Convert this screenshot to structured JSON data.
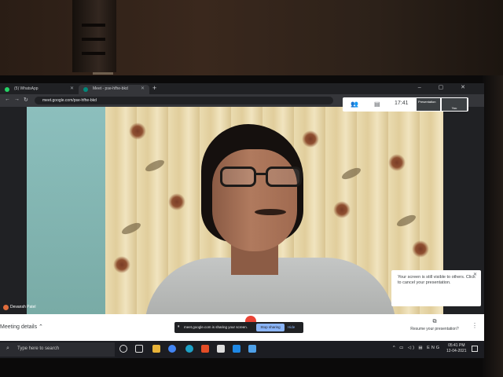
{
  "browser": {
    "tabs": [
      {
        "label": "(5) WhatsApp"
      },
      {
        "label": "Meet - pse-hfhe-bkd"
      }
    ],
    "new_tab": "+",
    "window_controls": "– ▢ ✕",
    "url": "meet.google.com/pse-hfhe-bkd"
  },
  "meet": {
    "clock": "17:41",
    "present_label": "Presentation",
    "you_label": "You",
    "avatar_letter": "D",
    "participant_name": "Devansh Patel",
    "popup_text": "Your screen is still visible to others. Click to cancel your presentation.",
    "meeting_details": "Meeting details",
    "resume_label": "Resume your presentation?",
    "share_message": "meet.google.com is sharing your screen.",
    "stop_sharing": "Stop sharing",
    "hide": "Hide"
  },
  "taskbar": {
    "search_placeholder": "Type here to search",
    "language": "ENG",
    "time": "05:41 PM",
    "date": "12-04-2021"
  },
  "colors": {
    "meet_bar": "#ffffff",
    "stop_button": "#8ab4f8",
    "taskbar": "#1c1d22"
  }
}
